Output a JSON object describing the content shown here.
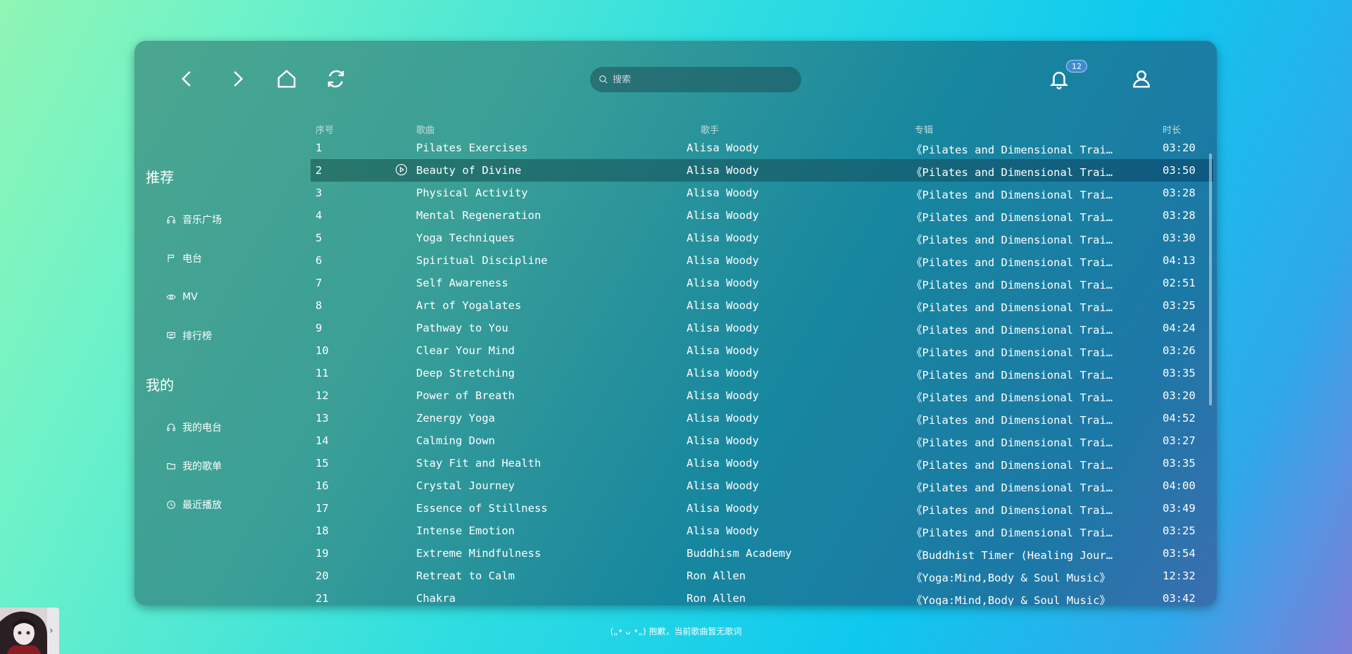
{
  "header": {
    "search_placeholder": "搜索",
    "notification_count": "12"
  },
  "sidebar": {
    "recommend_title": "推荐",
    "recommend_items": [
      "音乐广场",
      "电台",
      "MV",
      "排行榜"
    ],
    "mine_title": "我的",
    "mine_items": [
      "我的电台",
      "我的歌单",
      "最近播放"
    ]
  },
  "table": {
    "headers": {
      "index": "序号",
      "song": "歌曲",
      "artist": "歌手",
      "album": "专辑",
      "duration": "时长"
    },
    "rows": [
      {
        "idx": "1",
        "song": "Pilates Exercises",
        "artist": "Alisa Woody",
        "album": "《Pilates and Dimensional Trai…",
        "duration": "03:20"
      },
      {
        "idx": "2",
        "song": "Beauty of Divine",
        "artist": "Alisa Woody",
        "album": "《Pilates and Dimensional Trai…",
        "duration": "03:50"
      },
      {
        "idx": "3",
        "song": "Physical Activity",
        "artist": "Alisa Woody",
        "album": "《Pilates and Dimensional Trai…",
        "duration": "03:28"
      },
      {
        "idx": "4",
        "song": "Mental Regeneration",
        "artist": "Alisa Woody",
        "album": "《Pilates and Dimensional Trai…",
        "duration": "03:28"
      },
      {
        "idx": "5",
        "song": "Yoga Techniques",
        "artist": "Alisa Woody",
        "album": "《Pilates and Dimensional Trai…",
        "duration": "03:30"
      },
      {
        "idx": "6",
        "song": "Spiritual Discipline",
        "artist": "Alisa Woody",
        "album": "《Pilates and Dimensional Trai…",
        "duration": "04:13"
      },
      {
        "idx": "7",
        "song": "Self Awareness",
        "artist": "Alisa Woody",
        "album": "《Pilates and Dimensional Trai…",
        "duration": "02:51"
      },
      {
        "idx": "8",
        "song": "Art of Yogalates",
        "artist": "Alisa Woody",
        "album": "《Pilates and Dimensional Trai…",
        "duration": "03:25"
      },
      {
        "idx": "9",
        "song": "Pathway to You",
        "artist": "Alisa Woody",
        "album": "《Pilates and Dimensional Trai…",
        "duration": "04:24"
      },
      {
        "idx": "10",
        "song": "Clear Your Mind",
        "artist": "Alisa Woody",
        "album": "《Pilates and Dimensional Trai…",
        "duration": "03:26"
      },
      {
        "idx": "11",
        "song": "Deep Stretching",
        "artist": "Alisa Woody",
        "album": "《Pilates and Dimensional Trai…",
        "duration": "03:35"
      },
      {
        "idx": "12",
        "song": "Power of Breath",
        "artist": "Alisa Woody",
        "album": "《Pilates and Dimensional Trai…",
        "duration": "03:20"
      },
      {
        "idx": "13",
        "song": "Zenergy Yoga",
        "artist": "Alisa Woody",
        "album": "《Pilates and Dimensional Trai…",
        "duration": "04:52"
      },
      {
        "idx": "14",
        "song": "Calming Down",
        "artist": "Alisa Woody",
        "album": "《Pilates and Dimensional Trai…",
        "duration": "03:27"
      },
      {
        "idx": "15",
        "song": "Stay Fit and Health",
        "artist": "Alisa Woody",
        "album": "《Pilates and Dimensional Trai…",
        "duration": "03:35"
      },
      {
        "idx": "16",
        "song": "Crystal Journey",
        "artist": "Alisa Woody",
        "album": "《Pilates and Dimensional Trai…",
        "duration": "04:00"
      },
      {
        "idx": "17",
        "song": "Essence of Stillness",
        "artist": "Alisa Woody",
        "album": "《Pilates and Dimensional Trai…",
        "duration": "03:49"
      },
      {
        "idx": "18",
        "song": "Intense Emotion",
        "artist": "Alisa Woody",
        "album": "《Pilates and Dimensional Trai…",
        "duration": "03:25"
      },
      {
        "idx": "19",
        "song": "Extreme Mindfulness",
        "artist": "Buddhism Academy",
        "album": "《Buddhist Timer (Healing Jour…",
        "duration": "03:54"
      },
      {
        "idx": "20",
        "song": "Retreat to Calm",
        "artist": "Ron Allen",
        "album": "《Yoga:Mind,Body & Soul Music》",
        "duration": "12:32"
      },
      {
        "idx": "21",
        "song": "Chakra",
        "artist": "Ron Allen",
        "album": "《Yoga:Mind,Body & Soul Music》",
        "duration": "03:42"
      }
    ]
  },
  "player": {
    "lyric_text": "(„• ᴗ •„) 抱歉，当前歌曲暂无歌词"
  },
  "icons": {
    "back": "chevron-left-icon",
    "forward": "chevron-right-icon",
    "home": "home-icon",
    "refresh": "refresh-icon",
    "search": "search-icon",
    "bell": "bell-icon",
    "user": "user-icon",
    "play": "play-circle-icon"
  },
  "colors": {
    "badge": "#3d8bd8",
    "active_row": "#1e6a6e"
  }
}
